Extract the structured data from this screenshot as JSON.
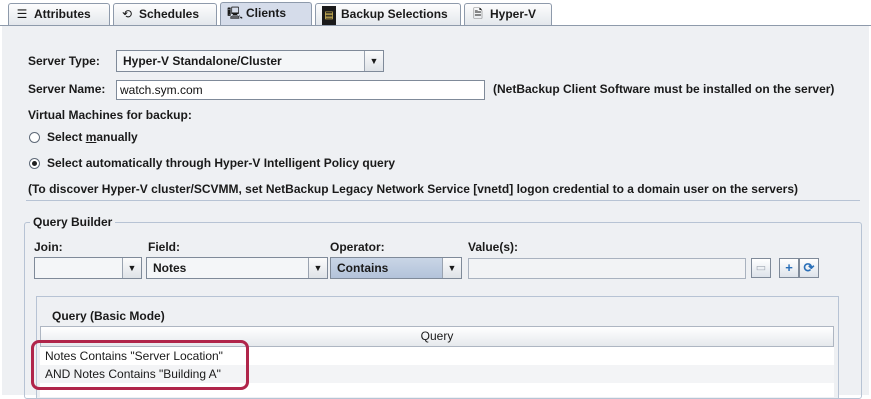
{
  "tabs": [
    {
      "label": "Attributes",
      "icon": "attributes-icon",
      "glyph": "☰"
    },
    {
      "label": "Schedules",
      "icon": "schedules-icon",
      "glyph": "⟲"
    },
    {
      "label": "Clients",
      "icon": "clients-icon",
      "glyph": "🖳"
    },
    {
      "label": "Backup Selections",
      "icon": "backup-selections-icon",
      "glyph": "▤"
    },
    {
      "label": "Hyper-V",
      "icon": "hyperv-icon",
      "glyph": "🗎"
    }
  ],
  "active_tab": "Clients",
  "form": {
    "server_type_label": "Server Type:",
    "server_type_value": "Hyper-V Standalone/Cluster",
    "server_name_label": "Server Name:",
    "server_name_value": "watch.sym.com",
    "server_name_note": "(NetBackup Client Software must be installed on the server)",
    "vm_label": "Virtual Machines for backup:",
    "radio_manual_pre": "Select ",
    "radio_manual_mnemonic": "m",
    "radio_manual_post": "anually",
    "radio_auto": "Select automatically through Hyper-V Intelligent Policy query",
    "selected_option": "auto",
    "discover_note": "(To discover Hyper-V cluster/SCVMM, set NetBackup Legacy Network Service [vnetd] logon credential to a domain user on the servers)"
  },
  "query_builder": {
    "title": "Query Builder",
    "join_label": "Join:",
    "join_value": "",
    "field_label": "Field:",
    "field_value": "Notes",
    "operator_label": "Operator:",
    "operator_value": "Contains",
    "values_label": "Value(s):",
    "values_value": "",
    "add_glyph": "+",
    "refresh_glyph": "⟳"
  },
  "query_table": {
    "title": "Query (Basic Mode)",
    "column": "Query",
    "rows": [
      "Notes Contains \"Server Location\"",
      "AND Notes Contains \"Building A\""
    ]
  },
  "colors": {
    "highlight": "#b0254a",
    "panel": "#eef0f3"
  }
}
